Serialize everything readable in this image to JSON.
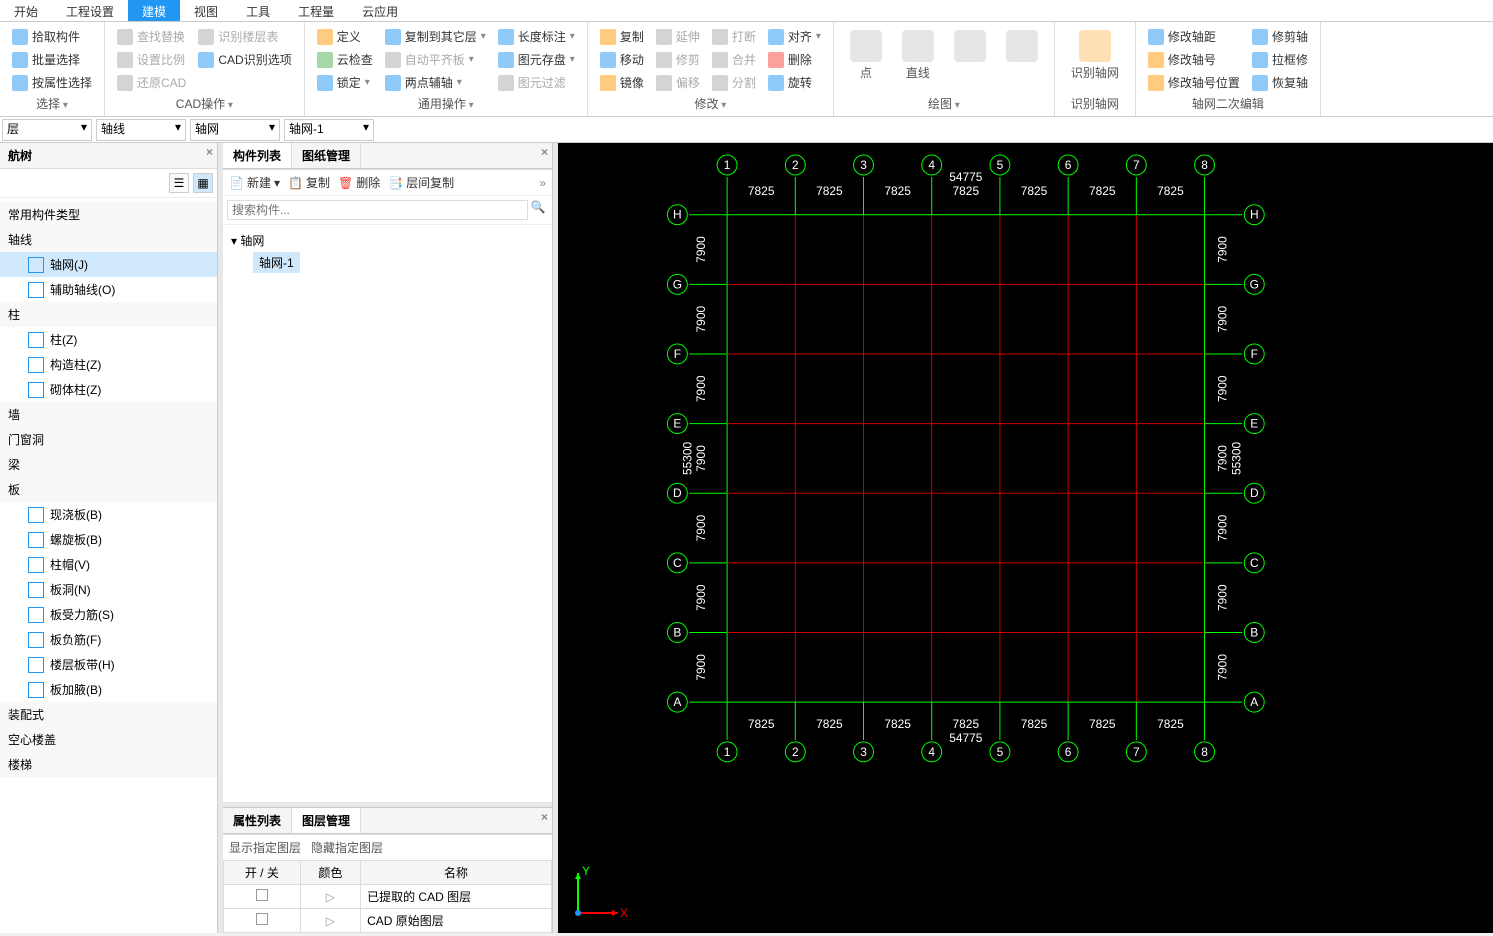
{
  "menubar": {
    "tabs": [
      "开始",
      "工程设置",
      "建模",
      "视图",
      "工具",
      "工程量",
      "云应用"
    ],
    "active": 2
  },
  "ribbon": {
    "groups": [
      {
        "label": "选择",
        "dropdown": true,
        "cols": [
          [
            {
              "t": "拾取构件",
              "i": "#2196f3"
            },
            {
              "t": "批量选择",
              "i": "#2196f3"
            },
            {
              "t": "按属性选择",
              "i": "#2196f3"
            }
          ]
        ]
      },
      {
        "label": "CAD操作",
        "dropdown": true,
        "cols": [
          [
            {
              "t": "查找替换",
              "i": "#aaa",
              "d": true
            },
            {
              "t": "设置比例",
              "i": "#aaa",
              "d": true
            },
            {
              "t": "还原CAD",
              "i": "#aaa",
              "d": true
            }
          ],
          [
            {
              "t": "识别楼层表",
              "i": "#aaa",
              "d": true
            },
            {
              "t": "CAD识别选项",
              "i": "#2196f3"
            },
            {
              "t": "",
              "i": ""
            }
          ]
        ]
      },
      {
        "label": "通用操作",
        "dropdown": true,
        "cols": [
          [
            {
              "t": "定义",
              "i": "#ff9800"
            },
            {
              "t": "云检查",
              "i": "#4caf50"
            },
            {
              "t": "锁定",
              "i": "#2196f3",
              "arrow": true
            }
          ],
          [
            {
              "t": "复制到其它层",
              "i": "#2196f3",
              "arrow": true
            },
            {
              "t": "自动平齐板",
              "i": "#aaa",
              "arrow": true,
              "d": true
            },
            {
              "t": "两点辅轴",
              "i": "#2196f3",
              "arrow": true
            }
          ],
          [
            {
              "t": "长度标注",
              "i": "#2196f3",
              "arrow": true
            },
            {
              "t": "图元存盘",
              "i": "#2196f3",
              "arrow": true
            },
            {
              "t": "图元过滤",
              "i": "#aaa",
              "d": true
            }
          ]
        ]
      },
      {
        "label": "修改",
        "dropdown": true,
        "cols": [
          [
            {
              "t": "复制",
              "i": "#ff9800"
            },
            {
              "t": "移动",
              "i": "#2196f3"
            },
            {
              "t": "镜像",
              "i": "#ff9800"
            }
          ],
          [
            {
              "t": "延伸",
              "i": "#aaa",
              "d": true
            },
            {
              "t": "修剪",
              "i": "#aaa",
              "d": true
            },
            {
              "t": "偏移",
              "i": "#aaa",
              "d": true
            }
          ],
          [
            {
              "t": "打断",
              "i": "#aaa",
              "d": true
            },
            {
              "t": "合并",
              "i": "#aaa",
              "d": true
            },
            {
              "t": "分割",
              "i": "#aaa",
              "d": true
            }
          ],
          [
            {
              "t": "对齐",
              "i": "#2196f3",
              "arrow": true
            },
            {
              "t": "删除",
              "i": "#f44336"
            },
            {
              "t": "旋转",
              "i": "#2196f3"
            }
          ]
        ]
      },
      {
        "label": "绘图",
        "dropdown": true,
        "big": [
          {
            "t": "点",
            "i": "#aaa",
            "d": true
          },
          {
            "t": "直线",
            "i": "#aaa",
            "d": true
          },
          {
            "t": "",
            "i": "#aaa",
            "d": true
          },
          {
            "t": "",
            "i": "#aaa",
            "d": true
          }
        ]
      },
      {
        "label": "识别轴网",
        "big": [
          {
            "t": "识别轴网",
            "i": "#ff9800"
          }
        ]
      },
      {
        "label": "轴网二次编辑",
        "cols": [
          [
            {
              "t": "修改轴距",
              "i": "#2196f3"
            },
            {
              "t": "修改轴号",
              "i": "#ff9800"
            },
            {
              "t": "修改轴号位置",
              "i": "#ff9800"
            }
          ],
          [
            {
              "t": "修剪轴",
              "i": "#2196f3"
            },
            {
              "t": "拉框修",
              "i": "#2196f3"
            },
            {
              "t": "恢复轴",
              "i": "#2196f3"
            }
          ]
        ]
      }
    ]
  },
  "selectors": {
    "layer": "层",
    "cat": "轴线",
    "type": "轴网",
    "name": "轴网-1"
  },
  "navtree": {
    "title": "航树",
    "common": "常用构件类型",
    "cats": [
      {
        "name": "轴线",
        "items": [
          {
            "t": "轴网(J)",
            "sel": true
          },
          {
            "t": "辅助轴线(O)"
          }
        ]
      },
      {
        "name": "柱",
        "items": [
          {
            "t": "柱(Z)"
          },
          {
            "t": "构造柱(Z)"
          },
          {
            "t": "砌体柱(Z)"
          }
        ]
      },
      {
        "name": "墙",
        "items": []
      },
      {
        "name": "门窗洞",
        "items": []
      },
      {
        "name": "梁",
        "items": []
      },
      {
        "name": "板",
        "items": [
          {
            "t": "现浇板(B)"
          },
          {
            "t": "螺旋板(B)"
          },
          {
            "t": "柱帽(V)"
          },
          {
            "t": "板洞(N)"
          },
          {
            "t": "板受力筋(S)"
          },
          {
            "t": "板负筋(F)"
          },
          {
            "t": "楼层板带(H)"
          },
          {
            "t": "板加腋(B)"
          }
        ]
      },
      {
        "name": "装配式",
        "items": []
      },
      {
        "name": "空心楼盖",
        "items": []
      },
      {
        "name": "楼梯",
        "items": []
      }
    ]
  },
  "complist": {
    "tabs": [
      "构件列表",
      "图纸管理"
    ],
    "toolbar": {
      "new": "新建",
      "copy": "复制",
      "del": "删除",
      "layercopy": "层间复制"
    },
    "search_ph": "搜索构件...",
    "head": "轴网",
    "item": "轴网-1"
  },
  "prop": {
    "tabs": [
      "属性列表",
      "图层管理"
    ],
    "show": "显示指定图层",
    "hide": "隐藏指定图层",
    "headers": [
      "开 / 关",
      "颜色",
      "名称"
    ],
    "rows": [
      "已提取的 CAD 图层",
      "CAD 原始图层"
    ]
  },
  "grid": {
    "cols": [
      "1",
      "2",
      "3",
      "4",
      "5",
      "6",
      "7",
      "8"
    ],
    "rows": [
      "A",
      "B",
      "C",
      "D",
      "E",
      "F",
      "G",
      "H"
    ],
    "hdim": "7825",
    "htotal": "54775",
    "vdim": "7900",
    "vtotal": "55300",
    "axis_x": "X",
    "axis_y": "Y"
  }
}
